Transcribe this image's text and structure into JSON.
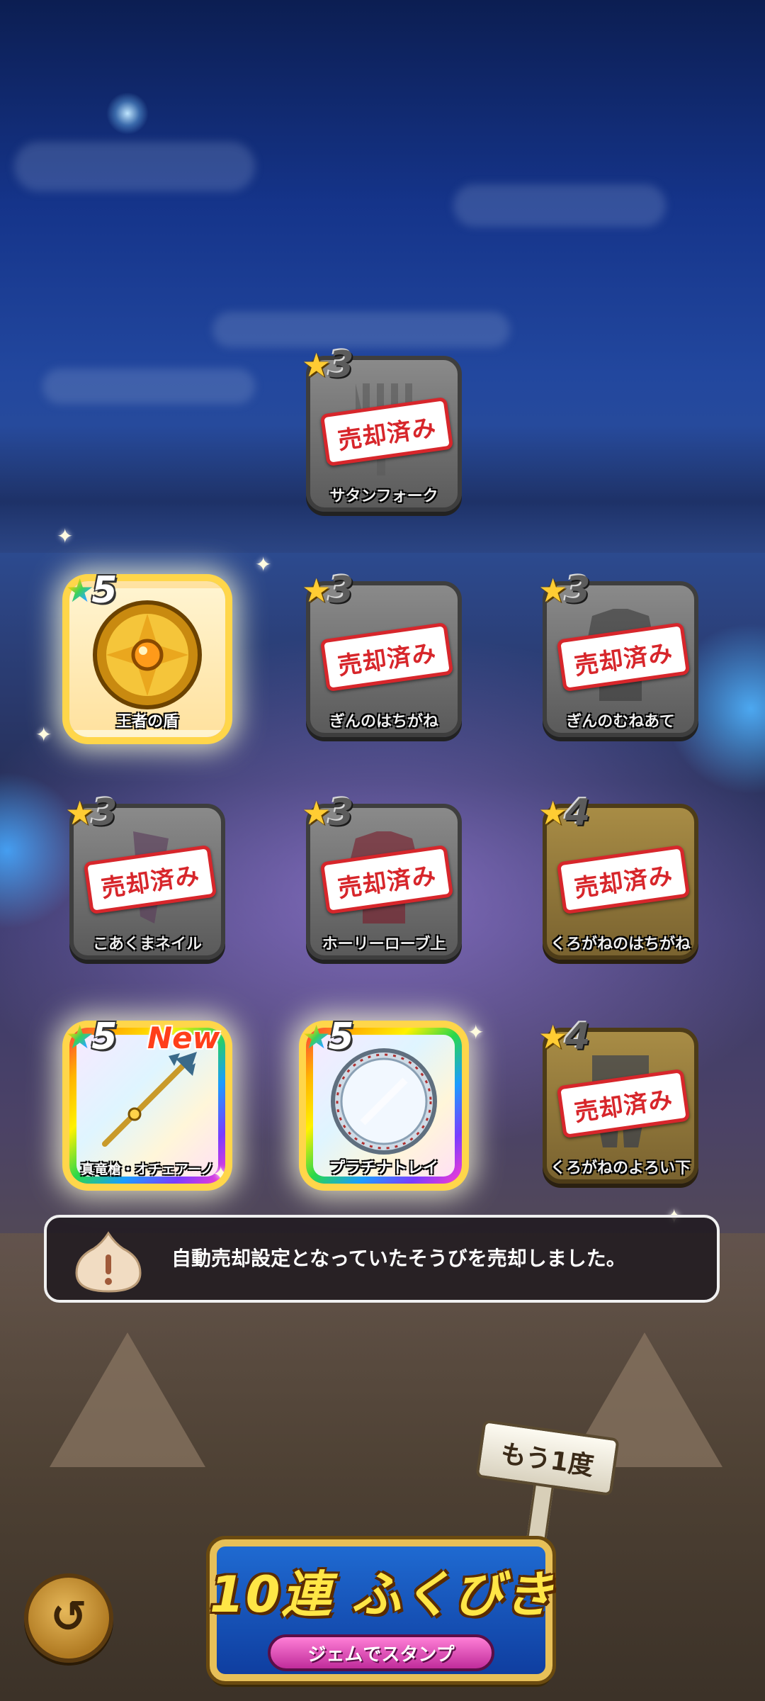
{
  "screen": {
    "message": "自動売却設定となっていたそうびを売却しました。",
    "again_label": "もう1度",
    "gacha_title": "10連 ふくびき",
    "gacha_sub": "ジェムでスタンプ",
    "back_icon": "back-arrow-icon"
  },
  "items": [
    {
      "name": "サタンフォーク",
      "stars": "3",
      "sold": "売却済み",
      "tier": "gray"
    },
    {
      "name": "王者の盾",
      "stars": "5",
      "tier": "rainbow"
    },
    {
      "name": "ぎんのはちがね",
      "stars": "3",
      "sold": "売却済み",
      "tier": "gray"
    },
    {
      "name": "ぎんのむねあて",
      "stars": "3",
      "sold": "売却済み",
      "tier": "gray"
    },
    {
      "name": "こあくまネイル",
      "stars": "3",
      "sold": "売却済み",
      "tier": "gray"
    },
    {
      "name": "ホーリーローブ上",
      "stars": "3",
      "sold": "売却済み",
      "tier": "gray"
    },
    {
      "name": "くろがねのはちがね",
      "stars": "4",
      "sold": "売却済み",
      "tier": "gold"
    },
    {
      "name": "真竜槍・オチェアーノ",
      "stars": "5",
      "badge": "New",
      "tier": "rainbow"
    },
    {
      "name": "プラチナトレイ",
      "stars": "5",
      "tier": "rainbow"
    },
    {
      "name": "くろがねのよろい下",
      "stars": "4",
      "sold": "売却済み",
      "tier": "gold"
    }
  ],
  "colors": {
    "sold_red": "#d7262b",
    "gacha_yellow": "#ffe646",
    "frame_gold": "#e7c058"
  }
}
